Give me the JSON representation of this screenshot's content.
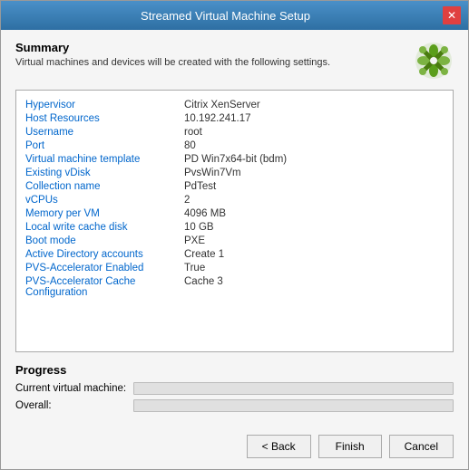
{
  "dialog": {
    "title": "Streamed Virtual Machine Setup",
    "close_label": "✕"
  },
  "summary": {
    "title": "Summary",
    "description": "Virtual machines and devices will be created with the following settings."
  },
  "info_rows": [
    {
      "label": "Hypervisor",
      "value": "Citrix XenServer"
    },
    {
      "label": "Host Resources",
      "value": "10.192.241.17"
    },
    {
      "label": "Username",
      "value": "root"
    },
    {
      "label": "Port",
      "value": "80"
    },
    {
      "label": "Virtual machine template",
      "value": "PD Win7x64-bit (bdm)"
    },
    {
      "label": "Existing vDisk",
      "value": "PvsWin7Vm"
    },
    {
      "label": "Collection name",
      "value": "PdTest"
    },
    {
      "label": "vCPUs",
      "value": "2"
    },
    {
      "label": "Memory per VM",
      "value": "4096 MB"
    },
    {
      "label": "Local write cache disk",
      "value": "10 GB"
    },
    {
      "label": "Boot mode",
      "value": "PXE"
    },
    {
      "label": "Active Directory accounts",
      "value": "Create 1"
    },
    {
      "label": "PVS-Accelerator Enabled",
      "value": "True"
    },
    {
      "label": "PVS-Accelerator Cache Configuration",
      "value": "Cache 3"
    }
  ],
  "progress": {
    "title": "Progress",
    "current_label": "Current virtual machine:",
    "overall_label": "Overall:"
  },
  "buttons": {
    "back": "< Back",
    "finish": "Finish",
    "cancel": "Cancel"
  }
}
